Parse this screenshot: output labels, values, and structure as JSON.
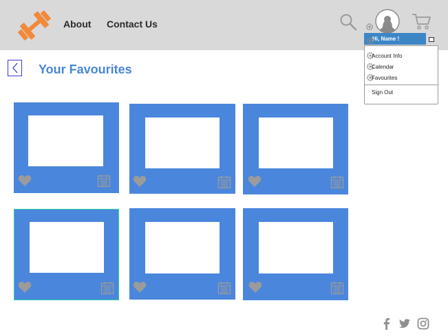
{
  "header": {
    "nav": {
      "about": "About",
      "contact": "Contact Us"
    }
  },
  "user_menu": {
    "greeting": "Hi, Name !",
    "items": [
      "Account Info",
      "Calendar",
      "Favourites"
    ],
    "sign_out": "Sign Out"
  },
  "page": {
    "title": "Your Favourites"
  },
  "colors": {
    "header_bg": "#d9d9d9",
    "card_bg": "#4a86dc",
    "accent": "#3d86c6",
    "title": "#4a86d6",
    "selected_border": "#2bd4a4",
    "logo": "#f08a3a"
  },
  "favourites": {
    "count": 6,
    "selected_index": 3
  },
  "footer": {
    "social": [
      "facebook-icon",
      "twitter-icon",
      "instagram-icon"
    ]
  }
}
